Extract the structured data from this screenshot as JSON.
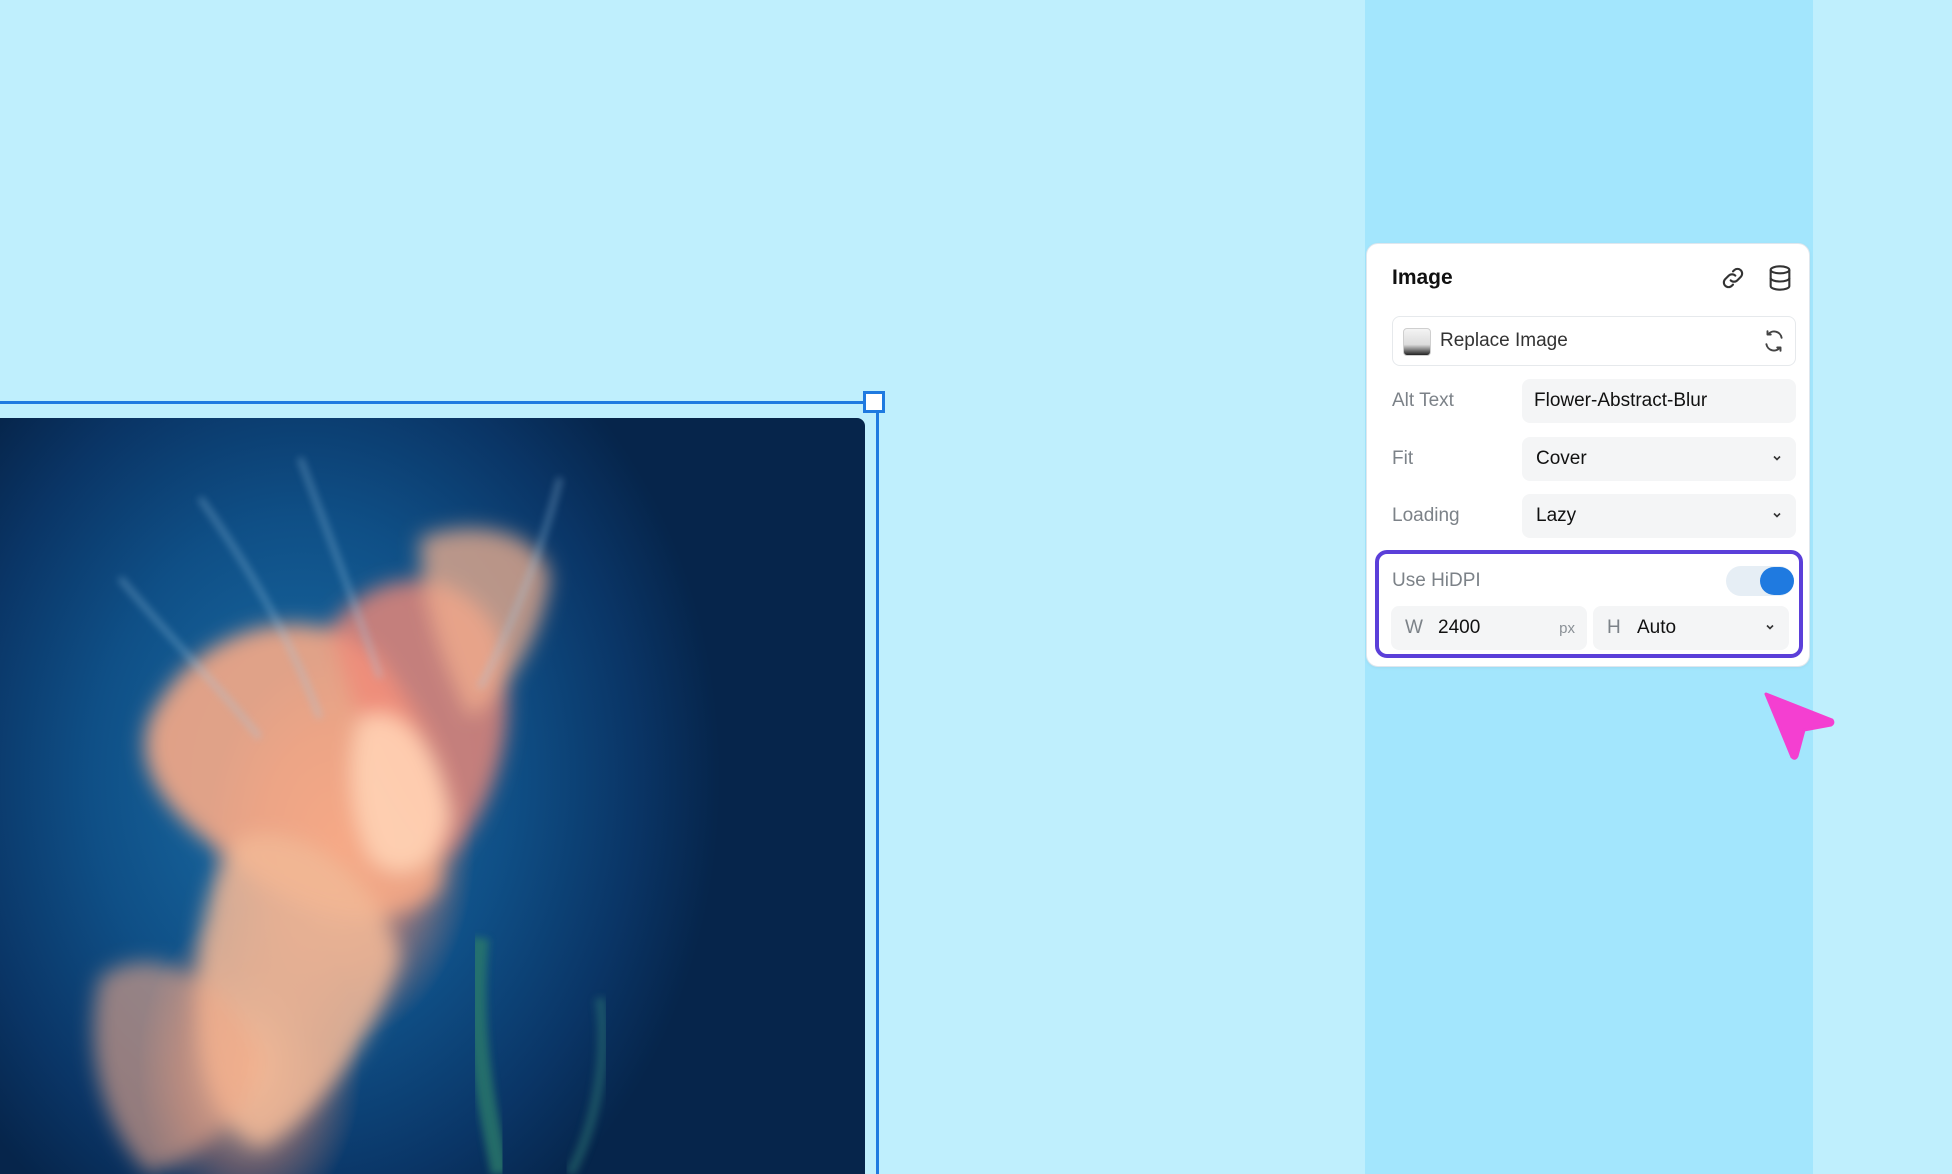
{
  "panel": {
    "title": "Image",
    "replace_label": "Replace Image",
    "fields": {
      "alt_text": {
        "label": "Alt Text",
        "value": "Flower-Abstract-Blur"
      },
      "fit": {
        "label": "Fit",
        "value": "Cover"
      },
      "loading": {
        "label": "Loading",
        "value": "Lazy"
      }
    },
    "hidpi": {
      "label": "Use HiDPI",
      "enabled": true,
      "width": {
        "letter": "W",
        "value": "2400",
        "unit": "px"
      },
      "height": {
        "letter": "H",
        "value": "Auto"
      }
    }
  },
  "colors": {
    "background": "#bfeffd",
    "stripe": "#a3e6fd",
    "accent": "#1f7ae0",
    "highlight": "#5b3fd9",
    "cursor": "#f43fd1"
  },
  "icons": [
    "link-icon",
    "database-icon",
    "swap-icon",
    "chevron-down-icon",
    "cursor-arrow-icon"
  ]
}
